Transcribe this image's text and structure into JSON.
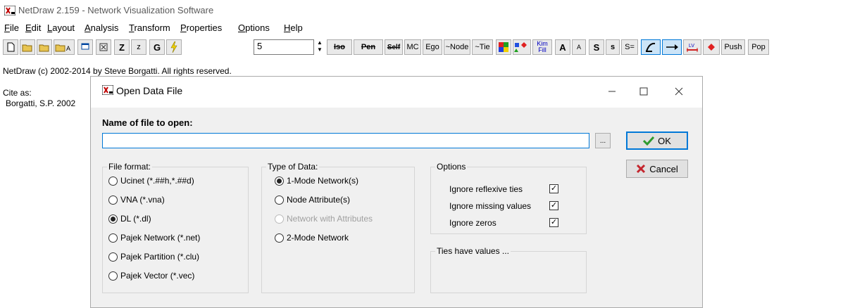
{
  "app": {
    "title": "NetDraw 2.159 - Network Visualization Software",
    "menu": [
      {
        "underline": "F",
        "rest": "ile"
      },
      {
        "underline": "E",
        "rest": "dit"
      },
      {
        "underline": "L",
        "rest": "ayout"
      },
      {
        "underline": "A",
        "rest": "nalysis"
      },
      {
        "underline": "T",
        "rest": "ransform"
      },
      {
        "underline": "P",
        "rest": "roperties"
      },
      {
        "underline": "O",
        "rest": "ptions"
      },
      {
        "underline": "H",
        "rest": "elp"
      }
    ],
    "toolbar": {
      "z_big": "Z",
      "z_small": "z",
      "g": "G",
      "number_value": "5",
      "iso": "Iso",
      "pen": "Pen",
      "self": "Self",
      "mc": "MC",
      "ego": "Ego",
      "node": "~Node",
      "tie": "~Tie",
      "kim_fill_top": "Kim",
      "kim_fill_bottom": "Fill",
      "a_big": "A",
      "a_small": "A",
      "s_big": "S",
      "s_small": "s",
      "s_eq": "S=",
      "push": "Push",
      "pop": "Pop"
    },
    "copyright": "NetDraw (c) 2002-2014 by Steve Borgatti. All rights reserved.",
    "cite_label": "Cite as:",
    "cite_text": "Borgatti, S.P. 2002"
  },
  "dialog": {
    "title": "Open Data File",
    "name_label": "Name of file to open:",
    "file_value": "",
    "browse_label": "...",
    "ok_label": "OK",
    "cancel_label": "Cancel",
    "file_format": {
      "label": "File format:",
      "options": [
        {
          "label": "Ucinet (*.##h,*.##d)",
          "selected": false
        },
        {
          "label": "VNA (*.vna)",
          "selected": false
        },
        {
          "label": "DL (*.dl)",
          "selected": true
        },
        {
          "label": "Pajek Network (*.net)",
          "selected": false
        },
        {
          "label": "Pajek Partition (*.clu)",
          "selected": false
        },
        {
          "label": "Pajek Vector (*.vec)",
          "selected": false
        }
      ]
    },
    "type_of_data": {
      "label": "Type of Data:",
      "options": [
        {
          "label": "1-Mode Network(s)",
          "selected": true,
          "disabled": false
        },
        {
          "label": "Node Attribute(s)",
          "selected": false,
          "disabled": false
        },
        {
          "label": "Network with Attributes",
          "selected": false,
          "disabled": true
        },
        {
          "label": "2-Mode Network",
          "selected": false,
          "disabled": false
        }
      ]
    },
    "options": {
      "label": "Options",
      "checks": [
        {
          "label": "Ignore reflexive ties",
          "checked": true
        },
        {
          "label": "Ignore missing values",
          "checked": true
        },
        {
          "label": "Ignore zeros",
          "checked": true
        }
      ]
    },
    "ties": {
      "label": "Ties have values ..."
    }
  },
  "colors": {
    "accent": "#0078d7",
    "ok_check": "#2e9b2e",
    "cancel_x": "#c4262e"
  }
}
